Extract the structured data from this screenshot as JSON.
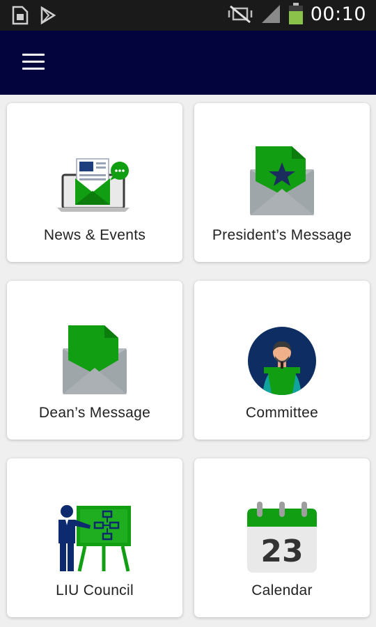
{
  "status_bar": {
    "time": "00:10",
    "icons": [
      "sim-card-icon",
      "play-store-icon",
      "mute-vibrate-icon",
      "signal-icon",
      "battery-icon"
    ]
  },
  "app_bar": {
    "menu_icon": "hamburger-menu-icon",
    "background": "#03033d"
  },
  "tiles": [
    {
      "label": "News & Events",
      "icon": "news-events-icon"
    },
    {
      "label": "President’s Message",
      "icon": "president-message-icon"
    },
    {
      "label": "Dean’s Message",
      "icon": "dean-message-icon"
    },
    {
      "label": "Committee",
      "icon": "committee-icon"
    },
    {
      "label": "LIU Council",
      "icon": "liu-council-icon"
    },
    {
      "label": "Calendar",
      "icon": "calendar-icon",
      "day": "23"
    }
  ],
  "colors": {
    "accent_green": "#129e12",
    "navy": "#0d2a6e",
    "envelope_gray": "#9fa6aa"
  }
}
